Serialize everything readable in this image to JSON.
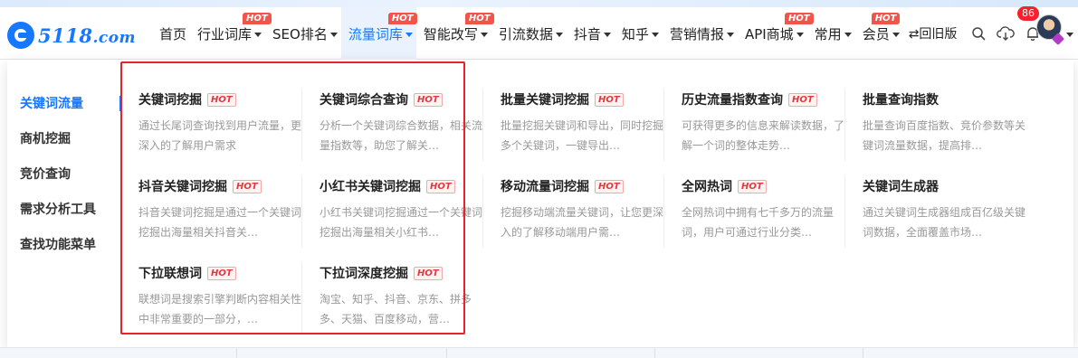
{
  "logo": {
    "text_main": "5118",
    "text_suffix": ".com"
  },
  "nav": {
    "items": [
      {
        "label": "首页",
        "has_caret": false,
        "hot": false
      },
      {
        "label": "行业词库",
        "has_caret": true,
        "hot": true
      },
      {
        "label": "SEO排名",
        "has_caret": true,
        "hot": false
      },
      {
        "label": "流量词库",
        "has_caret": true,
        "hot": true,
        "active": true
      },
      {
        "label": "智能改写",
        "has_caret": true,
        "hot": true
      },
      {
        "label": "引流数据",
        "has_caret": true,
        "hot": false
      },
      {
        "label": "抖音",
        "has_caret": true,
        "hot": false
      },
      {
        "label": "知乎",
        "has_caret": true,
        "hot": false
      },
      {
        "label": "营销情报",
        "has_caret": true,
        "hot": false
      },
      {
        "label": "API商城",
        "has_caret": true,
        "hot": true
      },
      {
        "label": "常用",
        "has_caret": true,
        "hot": false
      },
      {
        "label": "会员",
        "has_caret": true,
        "hot": true
      }
    ],
    "hot_label": "HOT",
    "back_old": "⇄回旧版"
  },
  "tools": {
    "notification_count": "86"
  },
  "sidebar": {
    "items": [
      {
        "label": "关键词流量",
        "active": true
      },
      {
        "label": "商机挖掘",
        "active": false
      },
      {
        "label": "竞价查询",
        "active": false
      },
      {
        "label": "需求分析工具",
        "active": false
      },
      {
        "label": "查找功能菜单",
        "active": false
      }
    ]
  },
  "cards": [
    {
      "title": "关键词挖掘",
      "hot": true,
      "desc": "通过长尾词查询找到用户流量，更深入的了解用户需求"
    },
    {
      "title": "关键词综合查询",
      "hot": true,
      "desc": "分析一个关键词综合数据，相关流量指数等，助您了解关…"
    },
    {
      "title": "批量关键词挖掘",
      "hot": true,
      "desc": "批量挖掘关键词和导出，同时挖掘多个关键词，一键导出…"
    },
    {
      "title": "历史流量指数查询",
      "hot": true,
      "desc": "可获得更多的信息来解读数据，了解一个词的整体走势…"
    },
    {
      "title": "批量查询指数",
      "hot": false,
      "desc": "批量查询百度指数、竞价参数等关键词流量数据，提高排…"
    },
    {
      "title": "抖音关键词挖掘",
      "hot": true,
      "desc": "抖音关键词挖掘是通过一个关键词挖掘出海量相关抖音关…"
    },
    {
      "title": "小红书关键词挖掘",
      "hot": true,
      "desc": "小红书关键词挖掘通过一个关键词挖掘出海量相关小红书…"
    },
    {
      "title": "移动流量词挖掘",
      "hot": true,
      "desc": "挖掘移动端流量关键词，让您更深入的了解移动端用户需…"
    },
    {
      "title": "全网热词",
      "hot": true,
      "desc": "全网热词中拥有七千多万的流量词，用户可通过行业分类…"
    },
    {
      "title": "关键词生成器",
      "hot": false,
      "desc": "通过关键词生成器组成百亿级关键词数据，全面覆盖市场…"
    },
    {
      "title": "下拉联想词",
      "hot": true,
      "desc": "联想词是搜索引擎判断内容相关性中非常重要的一部分，…"
    },
    {
      "title": "下拉词深度挖掘",
      "hot": true,
      "desc": "淘宝、知乎、抖音、京东、拼多多、天猫、百度移动，营…"
    }
  ],
  "colors": {
    "accent": "#1677ff",
    "hot_red": "#f2544b",
    "highlight_border": "#e6232a"
  }
}
